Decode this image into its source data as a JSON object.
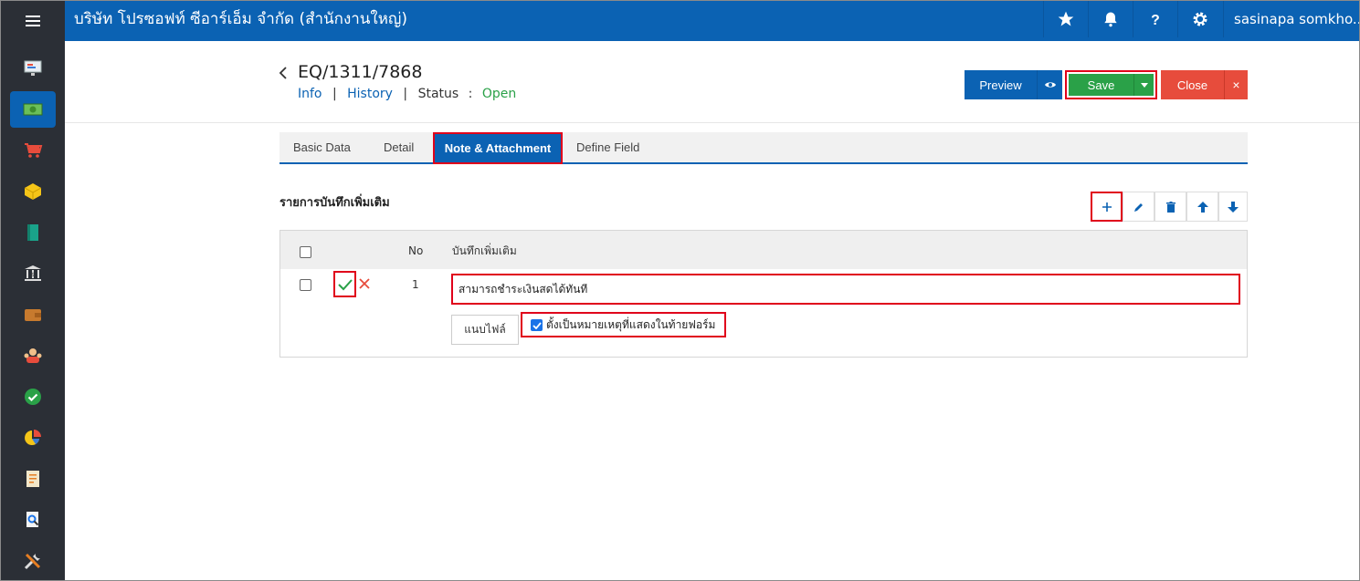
{
  "topbar": {
    "company": "บริษัท โปรซอฟท์ ซีอาร์เอ็ม จำกัด (สำนักงานใหญ่)",
    "icons": [
      "star-icon",
      "bell-icon",
      "help-icon",
      "gear-icon"
    ],
    "user": "sasinapa somkho..."
  },
  "sidebar": {
    "items": [
      "monitor-icon",
      "cash-icon",
      "cart-icon",
      "box-icon",
      "book-icon",
      "bank-icon",
      "wallet-icon",
      "people-icon",
      "check-circle-icon",
      "pie-chart-icon",
      "report-icon",
      "search-doc-icon",
      "tools-icon"
    ],
    "active_index": 1
  },
  "header": {
    "back": "<",
    "doc_no": "EQ/1311/7868",
    "links": {
      "info": "Info",
      "history": "History",
      "status_label": "Status",
      "status_colon": ":",
      "status_value": "Open",
      "sep": "|"
    }
  },
  "actions": {
    "preview": "Preview",
    "save": "Save",
    "close": "Close",
    "close_x": "×"
  },
  "tabs": [
    "Basic Data",
    "Detail",
    "Note & Attachment",
    "Define Field"
  ],
  "active_tab": "Note & Attachment",
  "notes": {
    "title": "รายการบันทึกเพิ่มเติม",
    "toolbar": [
      "add-icon",
      "edit-icon",
      "delete-icon",
      "arrow-up-icon",
      "arrow-down-icon"
    ],
    "columns": {
      "no": "No",
      "note": "บันทึกเพิ่มเติม"
    },
    "rows": [
      {
        "no": "1",
        "note": "สามารถชำระเงินสดได้ทันที",
        "attach_button": "แนบไฟล์",
        "footer_checkbox_label": "ตั้งเป็นหมายเหตุที่แสดงในท้ายฟอร์ม",
        "footer_checked": true
      }
    ]
  },
  "colors": {
    "primary": "#0b62b3",
    "success": "#2aa148",
    "danger": "#e74c3c",
    "highlight": "#e0001b",
    "sidebar": "#2b2f36"
  }
}
